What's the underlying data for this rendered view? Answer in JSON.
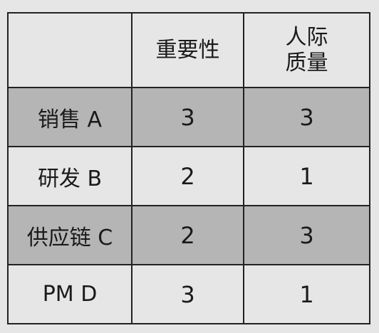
{
  "table": {
    "headers": [
      "",
      "重要性",
      "人际\n质量"
    ],
    "header_lines": {
      "col2_line1": "人际",
      "col2_line2": "质量"
    },
    "rows": [
      {
        "label": "销售 A",
        "importance": "3",
        "interpersonal_quality": "3",
        "shaded": true
      },
      {
        "label": "研发 B",
        "importance": "2",
        "interpersonal_quality": "1",
        "shaded": false
      },
      {
        "label": "供应链 C",
        "importance": "2",
        "interpersonal_quality": "3",
        "shaded": true
      },
      {
        "label": "PM D",
        "importance": "3",
        "interpersonal_quality": "1",
        "shaded": false
      }
    ]
  },
  "colors": {
    "header_text": "#6f2c91",
    "shaded_row": "#b5b5b5",
    "background": "#e6e6e6",
    "border": "#222222"
  }
}
